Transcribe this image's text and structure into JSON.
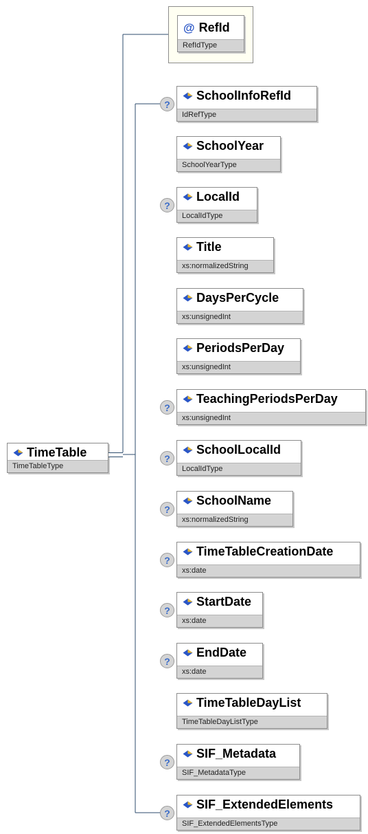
{
  "root": {
    "name": "TimeTable",
    "type": "TimeTableType"
  },
  "attribute": {
    "name": "RefId",
    "type": "RefIdType",
    "marker": "@"
  },
  "elements": [
    {
      "name": "SchoolInfoRefId",
      "type": "IdRefType",
      "optional": true
    },
    {
      "name": "SchoolYear",
      "type": "SchoolYearType",
      "optional": false
    },
    {
      "name": "LocalId",
      "type": "LocalIdType",
      "optional": true
    },
    {
      "name": "Title",
      "type": "xs:normalizedString",
      "optional": false
    },
    {
      "name": "DaysPerCycle",
      "type": "xs:unsignedInt",
      "optional": false
    },
    {
      "name": "PeriodsPerDay",
      "type": "xs:unsignedInt",
      "optional": false
    },
    {
      "name": "TeachingPeriodsPerDay",
      "type": "xs:unsignedInt",
      "optional": true
    },
    {
      "name": "SchoolLocalId",
      "type": "LocalIdType",
      "optional": true
    },
    {
      "name": "SchoolName",
      "type": "xs:normalizedString",
      "optional": true
    },
    {
      "name": "TimeTableCreationDate",
      "type": "xs:date",
      "optional": true
    },
    {
      "name": "StartDate",
      "type": "xs:date",
      "optional": true
    },
    {
      "name": "EndDate",
      "type": "xs:date",
      "optional": true
    },
    {
      "name": "TimeTableDayList",
      "type": "TimeTableDayListType",
      "optional": false
    },
    {
      "name": "SIF_Metadata",
      "type": "SIF_MetadataType",
      "optional": true
    },
    {
      "name": "SIF_ExtendedElements",
      "type": "SIF_ExtendedElementsType",
      "optional": true
    }
  ],
  "optional_marker": "?",
  "colors": {
    "connector": "#2c4b6c",
    "element_icon_blue": "#2a56c6",
    "element_icon_yellow": "#e8b62a",
    "type_bar": "#d4d4d4"
  }
}
